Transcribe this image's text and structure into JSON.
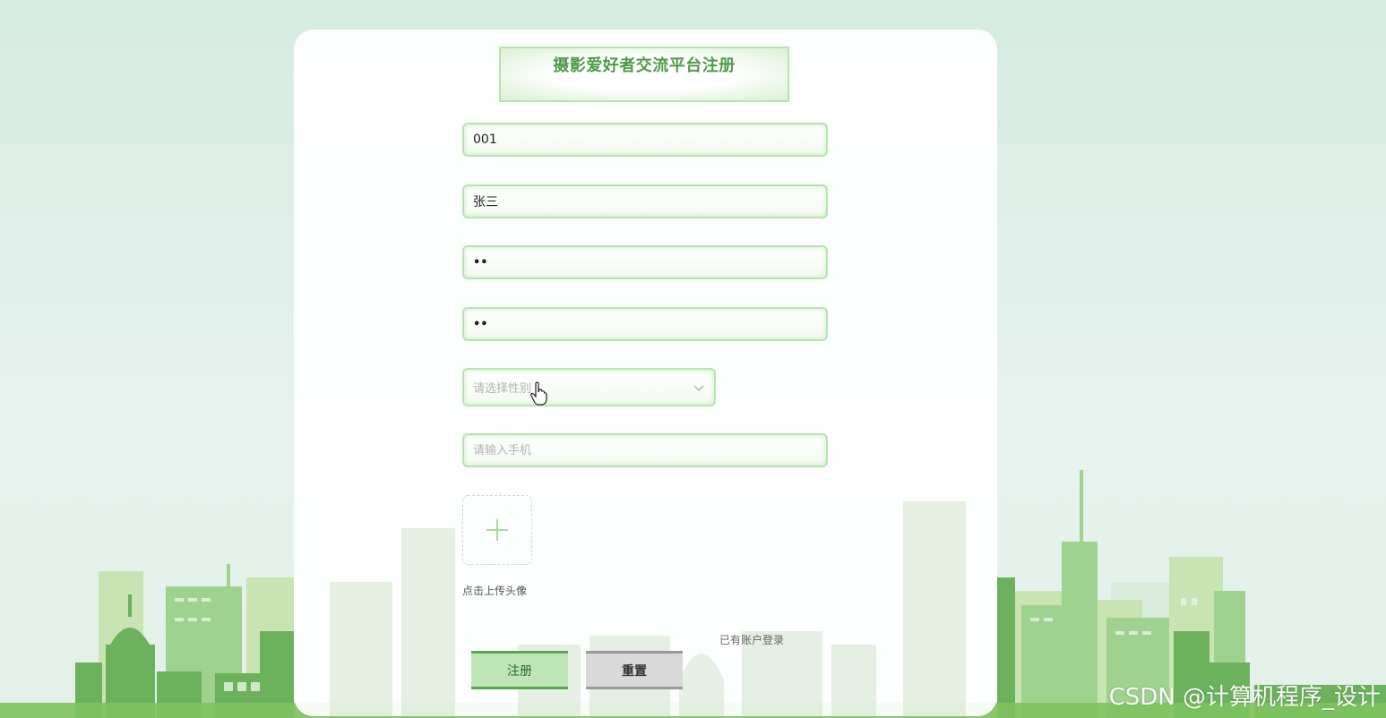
{
  "form": {
    "title": "摄影爱好者交流平台注册",
    "account_value": "001",
    "name_value": "张三",
    "password_mask": "••",
    "confirm_password_mask": "••",
    "gender_placeholder": "请选择性别",
    "phone_placeholder": "请输入手机",
    "upload_label": "点击上传头像",
    "login_link": "已有账户登录",
    "register_button": "注册",
    "reset_button": "重置"
  },
  "watermark": "CSDN @计算机程序_设计",
  "colors": {
    "accent_green": "#5aa64e",
    "field_border": "#b8e3b0",
    "title_text": "#4f9a4a"
  },
  "icons": [
    "chevron-down-icon",
    "plus-icon",
    "hand-pointer-icon"
  ]
}
